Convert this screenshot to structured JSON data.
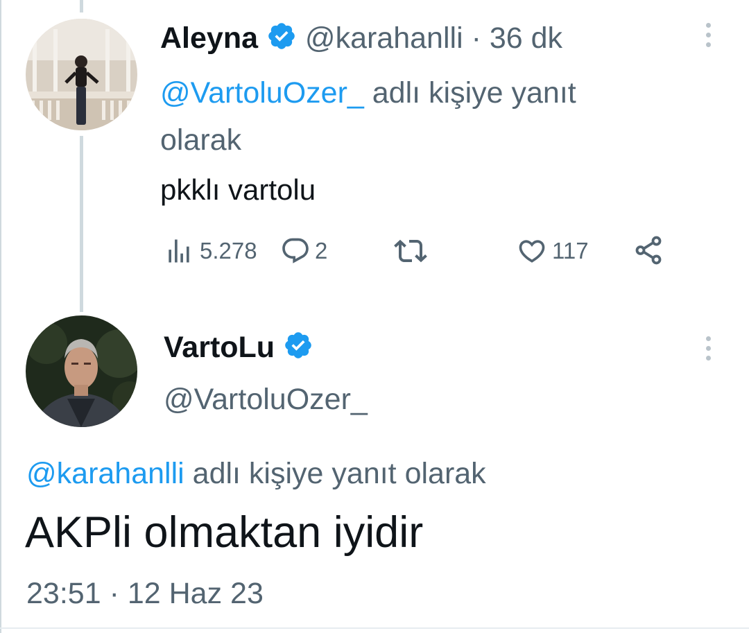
{
  "reply_tweet": {
    "display_name": "Aleyna",
    "handle": "@karahanlli",
    "separator": "·",
    "time_ago": "36 dk",
    "reply_to_handle": "@VartoluOzer_",
    "reply_suffix_line1": "adlı kişiye yanıt",
    "reply_suffix_line2": "olarak",
    "text": "pkklı vartolu",
    "views": "5.278",
    "replies": "2",
    "likes": "117"
  },
  "main_tweet": {
    "display_name": "VartoLu",
    "handle": "@VartoluOzer_",
    "reply_to_handle": "@karahanlli",
    "reply_suffix": "adlı kişiye yanıt olarak",
    "text": "AKPli olmaktan iyidir",
    "time": "23:51",
    "separator": "·",
    "date": "12 Haz 23"
  },
  "icons": {
    "verified": "verified-badge-icon",
    "views": "bar-chart-icon",
    "reply": "speech-bubble-icon",
    "retweet": "retweet-icon",
    "like": "heart-icon",
    "share": "share-icon",
    "more": "vertical-dots-icon"
  },
  "colors": {
    "accent": "#1d9bf0",
    "text": "#0f1419",
    "muted": "#536471"
  }
}
